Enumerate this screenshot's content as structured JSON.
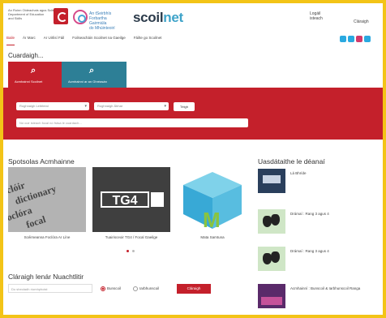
{
  "header": {
    "logo1_lines": [
      "An Roinn Oideachais agus Scileanna",
      "Department of Education",
      "and Skills"
    ],
    "pdst_lines": [
      "An tSeirbhís",
      "Forbartha Gairmiúla",
      "do Mhúinteoirí"
    ],
    "brand_main": "scoil",
    "brand_accent": "net",
    "login": "Logáil isteach",
    "register": "Cláraigh"
  },
  "nav": {
    "items": [
      "Baile",
      "Ár Marc",
      "Ar Uirlisí Fáil",
      "Foilseacháin Scoilnet na Gaeilge",
      "Fáilte go Scoilnet"
    ]
  },
  "social": {
    "icons": [
      "twitter-icon",
      "twitter-icon",
      "instagram-icon",
      "vimeo-icon"
    ],
    "colors": [
      "#2aa9e0",
      "#2aa9e0",
      "#d33a6a",
      "#2aa9e0"
    ]
  },
  "search": {
    "title": "Cuardaigh...",
    "tab1": "Acmhainní Scoilnet",
    "tab2": "Acmhainní ar an Ghréasán",
    "select1": "Roghnaigh Leibhéal",
    "select2": "Roghnaigh Ábhar",
    "submit": "Téigh",
    "freetext_placeholder": "Nó cuir isteach focal nó frása le cuardach..."
  },
  "spotlight": {
    "title": "Spotsolas Acmhainne",
    "items": [
      {
        "caption": "Scéimeanna Foclóra Ar Líne"
      },
      {
        "caption": "Tuairisceoir TG4 / Focal Gaeilge",
        "thumb_text": "TG4"
      },
      {
        "caption": "Mata Samtuna"
      }
    ]
  },
  "updates": {
    "title": "Uasdátaithe le déanaí",
    "items": [
      {
        "title": "Lá Bhríde"
      },
      {
        "title": "Drámaí : Rang 3 agus 4"
      },
      {
        "title": "Drámaí : Rang 3 agus 4"
      },
      {
        "title": "Acmhainní : Bunscoil & Iarbhunscoil Ranga"
      }
    ]
  },
  "register": {
    "title": "Cláraigh lenár Nuachtlitir",
    "email_placeholder": "Do sheoladh ríomhphoist",
    "radio1": "Bunscoil",
    "radio2": "Iarbhunscoil",
    "button": "Cláraigh"
  },
  "colors": {
    "accent_red": "#c4202b",
    "teal": "#2d7f96",
    "frame_yellow": "#f3c417"
  }
}
